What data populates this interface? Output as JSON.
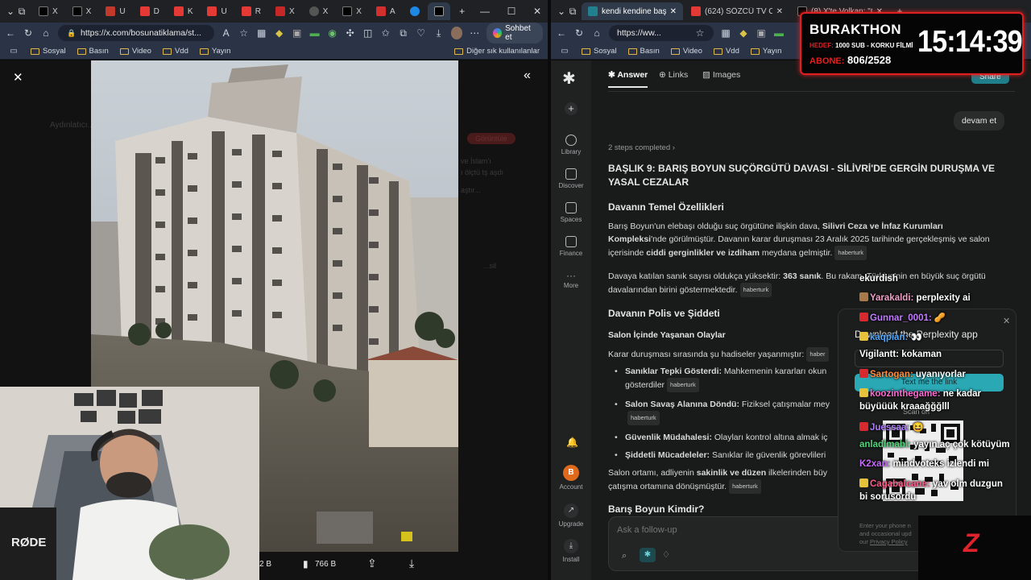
{
  "left_browser": {
    "tabs": [
      "U",
      "D",
      "K",
      "U",
      "R",
      "A"
    ],
    "url": "https://x.com/bosunatiklama/st...",
    "copilot_label": "Sohbet et",
    "bookmarks": [
      "Sosyal",
      "Basın",
      "Video",
      "Vdd",
      "Yayın"
    ],
    "other_bookmarks": "Diğer sık kullanılanlar"
  },
  "viewer": {
    "bg_texts": [
      "Aydınlatıcı...",
      "ve İslam'ı",
      "ı ölçtü tş aşdı",
      "aştır...",
      "Görüntüle",
      "...sil"
    ],
    "stats": [
      {
        "label": "2 B"
      },
      {
        "label": "766 B"
      }
    ]
  },
  "right_browser": {
    "tabs": [
      "kendi kendine başlıkları gir",
      "(624) SÖZCÜ TV Canlı Yayı",
      "(8) X'te Volkan: \"CV'e foto..."
    ],
    "url": "https://ww...",
    "bookmarks": [
      "Sosyal",
      "Basın",
      "Video",
      "Vdd",
      "Yayın"
    ]
  },
  "stream": {
    "title": "BURAKTHON",
    "goal_label": "HEDEF:",
    "goal_text": "1000 SUB - KORKU FİLMİ",
    "subs_label": "ABONE:",
    "subs_value": "806/2528",
    "clock": "15:14:39"
  },
  "perplexity": {
    "tabs": [
      "Answer",
      "Links",
      "Images"
    ],
    "share": "Share",
    "nav": [
      "Library",
      "Discover",
      "Spaces",
      "Finance",
      "More"
    ],
    "nav_bottom": [
      "Account",
      "Upgrade",
      "Install"
    ],
    "account_initial": "B",
    "user_query": "devam et",
    "steps": "2 steps completed",
    "heading": "BAŞLIK 9: BARIŞ BOYUN SUÇÖRGÜTÜ DAVASI - SİLİVRİ'DE GERGİN DURUŞMA VE YASAL CEZALAR",
    "sec1": "Davanın Temel Özellikleri",
    "p1a": "Barış Boyun'un elebaşı olduğu suç örgütüne ilişkin dava, ",
    "p1b": "Silivri Ceza ve İnfaz Kurumları Kompleksi",
    "p1c": "'nde görülmüştür. Davanın karar duruşması 23 Aralık 2025 tarihinde gerçekleşmiş ve salon içerisinde ",
    "p1d": "ciddi gerginlikler ve izdiham",
    "p1e": " meydana gelmiştir.",
    "source": "haberturk",
    "p2a": "Davaya katılan sanık sayısı oldukça yüksektir: ",
    "p2b": "363 sanık",
    "p2c": ". Bu rakam, Türkiye'nin en büyük suç örgütü davalarından birini göstermektedir.",
    "sec2": "Davanın Polis ve Şiddeti",
    "sub1": "Salon İçinde Yaşanan Olaylar",
    "p3": "Karar duruşması sırasında şu hadiseler yaşanmıştır:",
    "bullets": [
      {
        "b": "Sanıklar Tepki Gösterdi:",
        "t": " Mahkemenin kararları okun",
        "t2": "gösterdiler"
      },
      {
        "b": "Salon Savaş Alanına Döndü:",
        "t": " Fiziksel çatışmalar mey",
        "t2": ""
      },
      {
        "b": "Güvenlik Müdahalesi:",
        "t": " Olayları kontrol altına almak iç",
        "t2": ""
      },
      {
        "b": "Şiddetli Mücadeleler:",
        "t": " Sanıklar ile güvenlik görevlileri",
        "t2": ""
      }
    ],
    "p4a": "Salon ortamı, adliyenin ",
    "p4b": "sakinlik ve düzen",
    "p4c": " ilkelerinden büy",
    "p4d": "çatışma ortamına dönüşmüştür.",
    "sec3": "Barış Boyun Kimdir?",
    "followup_placeholder": "Ask a follow-up",
    "promo_text": "Download the Perplexity app",
    "promo_button": "Text me the link",
    "promo_scan": "Scan on",
    "promo_small": [
      "Enter your phone n",
      "and occasional upd",
      "our"
    ],
    "promo_policy": "Privacy Policy"
  },
  "chat": [
    {
      "user": "ekurdish",
      "msg": "",
      "color": "#ffffff",
      "badge": ""
    },
    {
      "user": "Yarakaldi",
      "msg": "perplexity ai",
      "color": "#f0a0c8",
      "badge": "#a87a4a"
    },
    {
      "user": "Gunnar_0001",
      "msg": "🥜",
      "color": "#c27cff",
      "badge": "#d8292f"
    },
    {
      "user": "kaqpian",
      "msg": "👀",
      "color": "#4ea8ff",
      "badge": "#e6c23a"
    },
    {
      "user": "Vigilantt",
      "msg": "kokaman",
      "color": "#ffffff",
      "badge": ""
    },
    {
      "user": "Sartogan",
      "msg": "uyanıyorlar",
      "color": "#ff8a3d",
      "badge": "#d8292f"
    },
    {
      "user": "koozinthegame",
      "msg": "ne kadar",
      "color": "#ff6ad5",
      "badge": "#e6c23a"
    },
    {
      "user": "",
      "msg": "büyüüük kraaağğğlll",
      "color": "#ffffff",
      "badge": ""
    },
    {
      "user": "Juessaa",
      "msg": "😆",
      "color": "#b07cff",
      "badge": "#d8292f"
    },
    {
      "user": "anladimabi",
      "msg": "yayın aç çok kötüyüm",
      "color": "#4fd67a",
      "badge": ""
    },
    {
      "user": "K2xan",
      "msg": "mindvoteks izlendi mi",
      "color": "#c86bff",
      "badge": ""
    },
    {
      "user": "Cagabalcane",
      "msg": "yav olm duzgun",
      "color": "#ff5b8a",
      "badge": "#e6c23a"
    },
    {
      "user": "",
      "msg": "bi sorusordu",
      "color": "#ffffff",
      "badge": ""
    }
  ]
}
